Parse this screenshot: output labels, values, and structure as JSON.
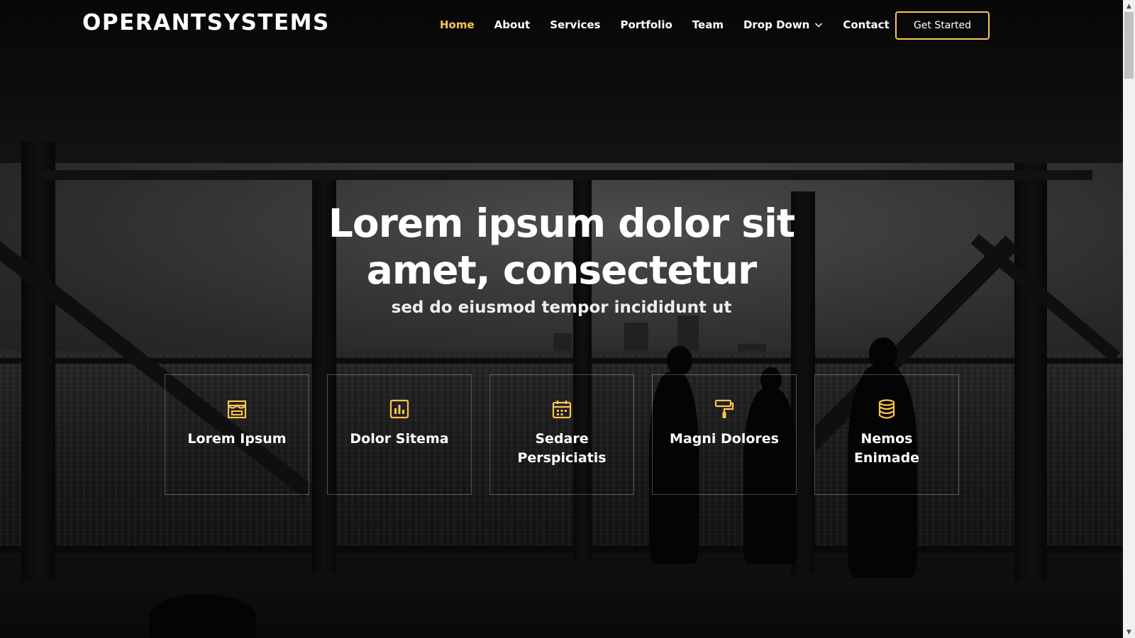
{
  "header": {
    "logo": "OPERANTSYSTEMS",
    "nav": [
      {
        "label": "Home",
        "active": true
      },
      {
        "label": "About"
      },
      {
        "label": "Services"
      },
      {
        "label": "Portfolio"
      },
      {
        "label": "Team"
      },
      {
        "label": "Drop Down",
        "icon": "chevron-down-icon"
      },
      {
        "label": "Contact"
      }
    ],
    "cta_label": "Get Started"
  },
  "hero": {
    "title_line1": "Lorem ipsum dolor sit",
    "title_line2": "amet, consectetur",
    "subtitle": "sed do eiusmod tempor incididunt ut"
  },
  "features": [
    {
      "title": "Lorem Ipsum",
      "icon": "store-icon"
    },
    {
      "title": "Dolor Sitema",
      "icon": "bar-chart-icon"
    },
    {
      "title": "Sedare Perspiciatis",
      "icon": "calendar-icon"
    },
    {
      "title": "Magni Dolores",
      "icon": "paint-roller-icon"
    },
    {
      "title": "Nemos Enimade",
      "icon": "database-icon"
    }
  ],
  "colors": {
    "accent": "#ffc451",
    "text": "#ffffff",
    "background": "#151515"
  }
}
